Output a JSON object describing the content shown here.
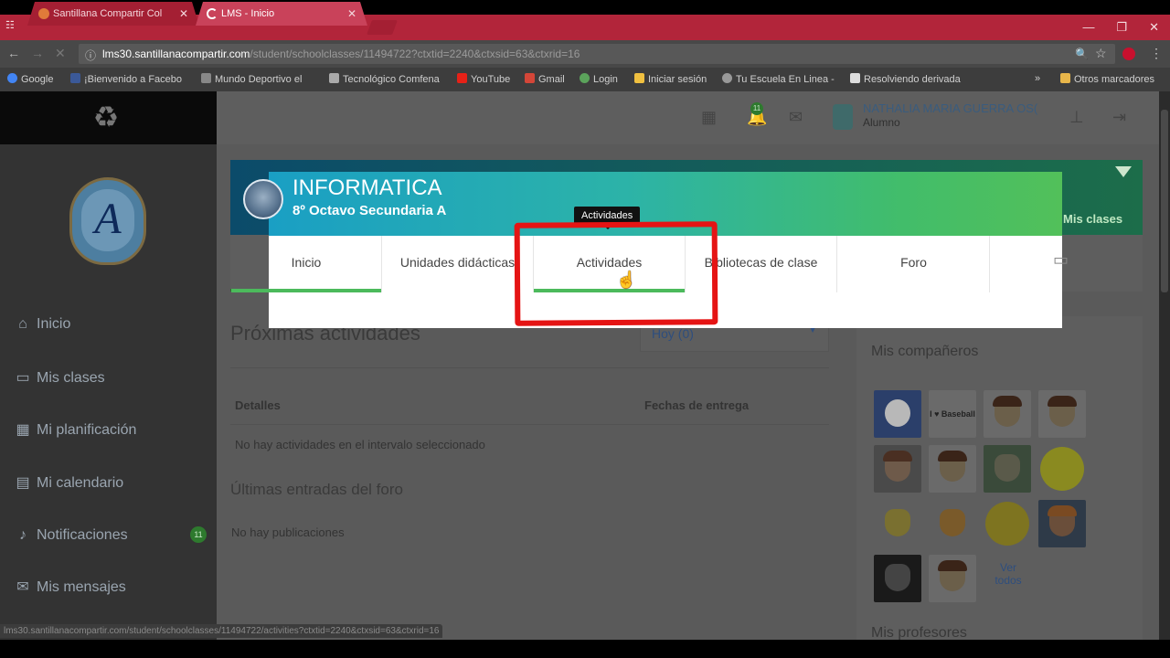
{
  "browser": {
    "tabs": [
      {
        "title": "Santillana Compartir Col",
        "close": "✕"
      },
      {
        "title": "LMS - Inicio",
        "close": "✕"
      }
    ],
    "window_buttons": [
      "—",
      "❐",
      "✕"
    ],
    "url_host": "lms30.santillanacompartir.com",
    "url_rest": "/student/schoolclasses/11494722?ctxtid=2240&ctxsid=63&ctxrid=16",
    "bookmarks": [
      "Google",
      "¡Bienvenido a Facebo",
      "Mundo Deportivo el",
      "Tecnológico Comfena",
      "YouTube",
      "Gmail",
      "Login",
      "Iniciar sesión",
      "Tu Escuela En Linea -",
      "Resolviendo derivada"
    ],
    "bookmarks_more": "»",
    "other_bookmarks": "Otros marcadores",
    "icons": {
      "back": "←",
      "forward": "→",
      "reload": "↻",
      "info": "ⓘ",
      "zoom": "🔍",
      "star": "☆",
      "menu": "⋮"
    }
  },
  "sidebar": {
    "items": [
      {
        "label": "Inicio",
        "icon": "⌂"
      },
      {
        "label": "Mis clases",
        "icon": "▭"
      },
      {
        "label": "Mi planificación",
        "icon": "▦"
      },
      {
        "label": "Mi calendario",
        "icon": "▤"
      },
      {
        "label": "Notificaciones",
        "icon": "♫"
      },
      {
        "label": "Mis mensajes",
        "icon": "✉"
      }
    ],
    "notif_count": "11",
    "crest_letter": "A"
  },
  "header": {
    "bell_count": "11",
    "user_name": "NATHALIA MARIA GUERRA OS(",
    "user_role": "Alumno"
  },
  "course": {
    "title": "INFORMATICA",
    "subtitle": "8º Octavo Secundaria A",
    "mis_clases": "Mis clases",
    "tabs": [
      "Inicio",
      "Unidades didácticas",
      "Actividades",
      "Bibliotecas de clase",
      "Foro"
    ],
    "tooltip": "Actividades"
  },
  "main": {
    "proximas_title": "Próximas actividades",
    "date_filter": "Hoy (0)",
    "col_detalles": "Detalles",
    "col_fechas": "Fechas de entrega",
    "no_activities": "No hay actividades en el intervalo seleccionado",
    "foro_title": "Últimas entradas del foro",
    "no_posts": "No hay publicaciones"
  },
  "right": {
    "companeros_title": "Mis compañeros",
    "ver_todos": "Ver todos",
    "profesores_title": "Mis profesores",
    "baseball_text": "I ♥ Baseball"
  },
  "status_url": "lms30.santillanacompartir.com/student/schoolclasses/11494722/activities?ctxtid=2240&ctxsid=63&ctxrid=16"
}
